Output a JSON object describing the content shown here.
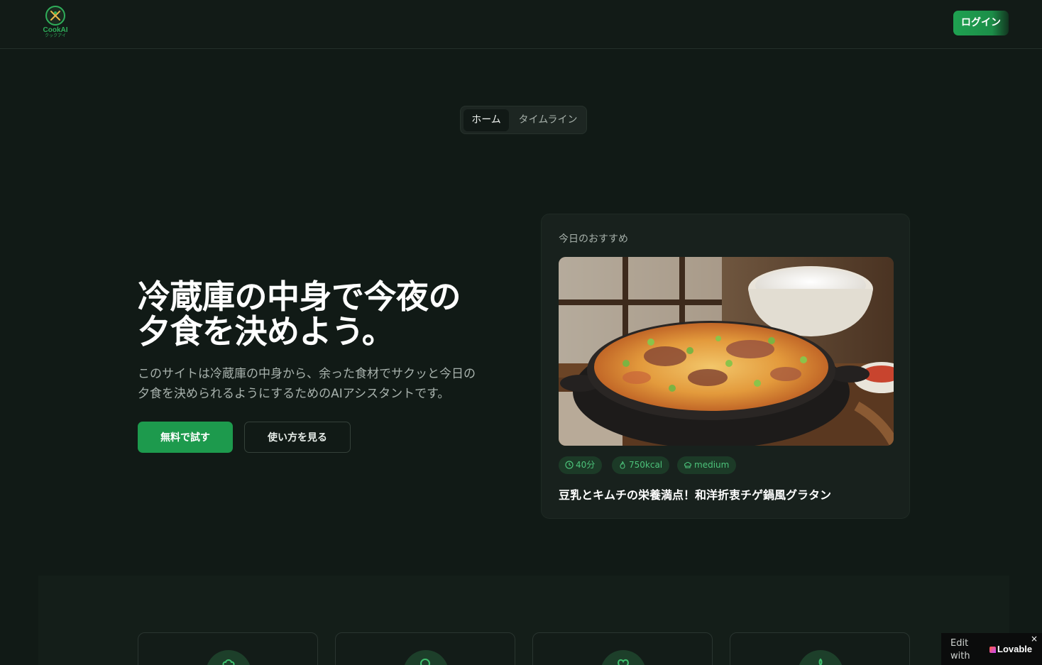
{
  "header": {
    "logo": {
      "name": "CookAI",
      "sub": "クックアイ"
    },
    "login_label": "ログイン"
  },
  "tabs": [
    {
      "label": "ホーム",
      "active": true
    },
    {
      "label": "タイムライン",
      "active": false
    }
  ],
  "hero": {
    "headline_line1": "冷蔵庫の中身で今夜の",
    "headline_line2": "夕食を決めよう。",
    "desc_line1": "このサイトは冷蔵庫の中身から、余った食材でサクッと今日の",
    "desc_line2": "夕食を決められるようにするためのAIアシスタントです。",
    "primary_button": "無料で試す",
    "secondary_button": "使い方を見る"
  },
  "recommendation": {
    "label": "今日のおすすめ",
    "time": "40分",
    "calories": "750kcal",
    "difficulty": "medium",
    "title": "豆乳とキムチの栄養満点！和洋折衷チゲ鍋風グラタン"
  },
  "lovable": {
    "edit_line1": "Edit",
    "edit_line2": "with",
    "brand": "Lovable",
    "close": "×"
  },
  "colors": {
    "background": "#111a16",
    "accent": "#1d9a4d",
    "badge_bg": "#1c3a27",
    "badge_text": "#4cc27a"
  },
  "icons": [
    "clock-icon",
    "flame-icon",
    "chef-hat-icon",
    "heart-icon",
    "search-icon",
    "leaf-icon"
  ]
}
